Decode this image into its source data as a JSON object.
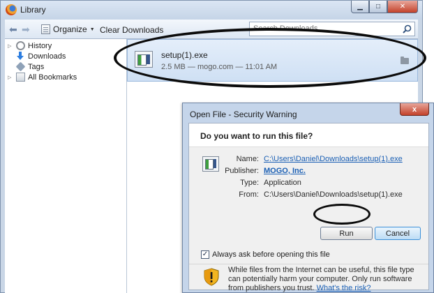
{
  "library": {
    "title": "Library",
    "toolbar": {
      "organize_label": "Organize",
      "clear_downloads_label": "Clear Downloads",
      "search_placeholder": "Search Downloads"
    },
    "sidebar": {
      "items": [
        {
          "label": "History",
          "icon": "history-icon"
        },
        {
          "label": "Downloads",
          "icon": "download-arrow-icon"
        },
        {
          "label": "Tags",
          "icon": "tag-icon"
        },
        {
          "label": "All Bookmarks",
          "icon": "bookmarks-icon"
        }
      ]
    },
    "download": {
      "filename": "setup(1).exe",
      "meta": "2.5 MB — mogo.com — 11:01 AM"
    }
  },
  "dialog": {
    "title": "Open File - Security Warning",
    "close_label": "x",
    "question": "Do you want to run this file?",
    "properties": [
      {
        "label": "Name:",
        "value": "C:\\Users\\Daniel\\Downloads\\setup(1).exe"
      },
      {
        "label": "Publisher:",
        "value": "MOGO, Inc."
      },
      {
        "label": "Type:",
        "value": "Application"
      },
      {
        "label": "From:",
        "value": "C:\\Users\\Daniel\\Downloads\\setup(1).exe"
      }
    ],
    "run_label": "Run",
    "cancel_label": "Cancel",
    "checkbox_label": "Always ask before opening this file",
    "checkbox_mark": "✓",
    "warning_text": "While files from the Internet can be useful, this file type can potentially harm your computer. Only run software from publishers you trust.",
    "warning_link": "What's the risk?"
  },
  "colors": {
    "link": "#1a5fb4",
    "annotation": "#0b0b0b",
    "close_button": "#c3412a"
  }
}
